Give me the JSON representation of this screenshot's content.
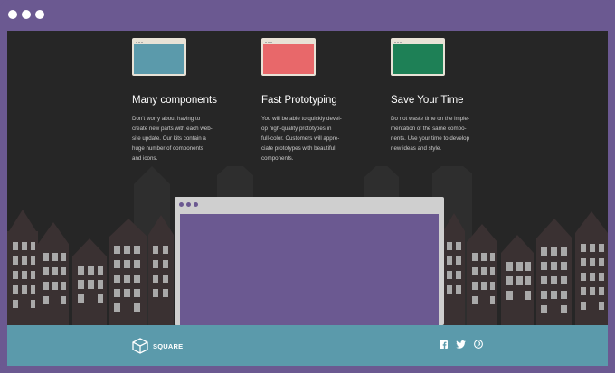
{
  "window": {
    "dots": [
      "red",
      "yellow",
      "green"
    ]
  },
  "features": [
    {
      "title": "Many components",
      "text": "Don't worry about having to\ncreate new parts with each web-\nsite update. Our kits contain a\nhuge number of components\nand icons.",
      "thumb_color": "#5b9aab"
    },
    {
      "title": "Fast Prototyping",
      "text": "You will be able to quickly devel-\nop high-quality prototypes in\nfull-color. Customers will appre-\nciate prototypes with beautiful\ncomponents.",
      "thumb_color": "#e8686a"
    },
    {
      "title": "Save Your Time",
      "text": "Do not waste time on the imple-\nmentation of the same compo-\nnents. Use your time to develop\nnew ideas and style.",
      "thumb_color": "#1e8056"
    }
  ],
  "footer": {
    "brand": "SQUARE",
    "icons": [
      "facebook-icon",
      "twitter-icon",
      "pinterest-icon"
    ]
  },
  "colors": {
    "frame": "#6b5991",
    "stage": "#262626",
    "footer": "#5b9aab",
    "buildings": "#3a3132",
    "windows": "#a9a9a9"
  }
}
